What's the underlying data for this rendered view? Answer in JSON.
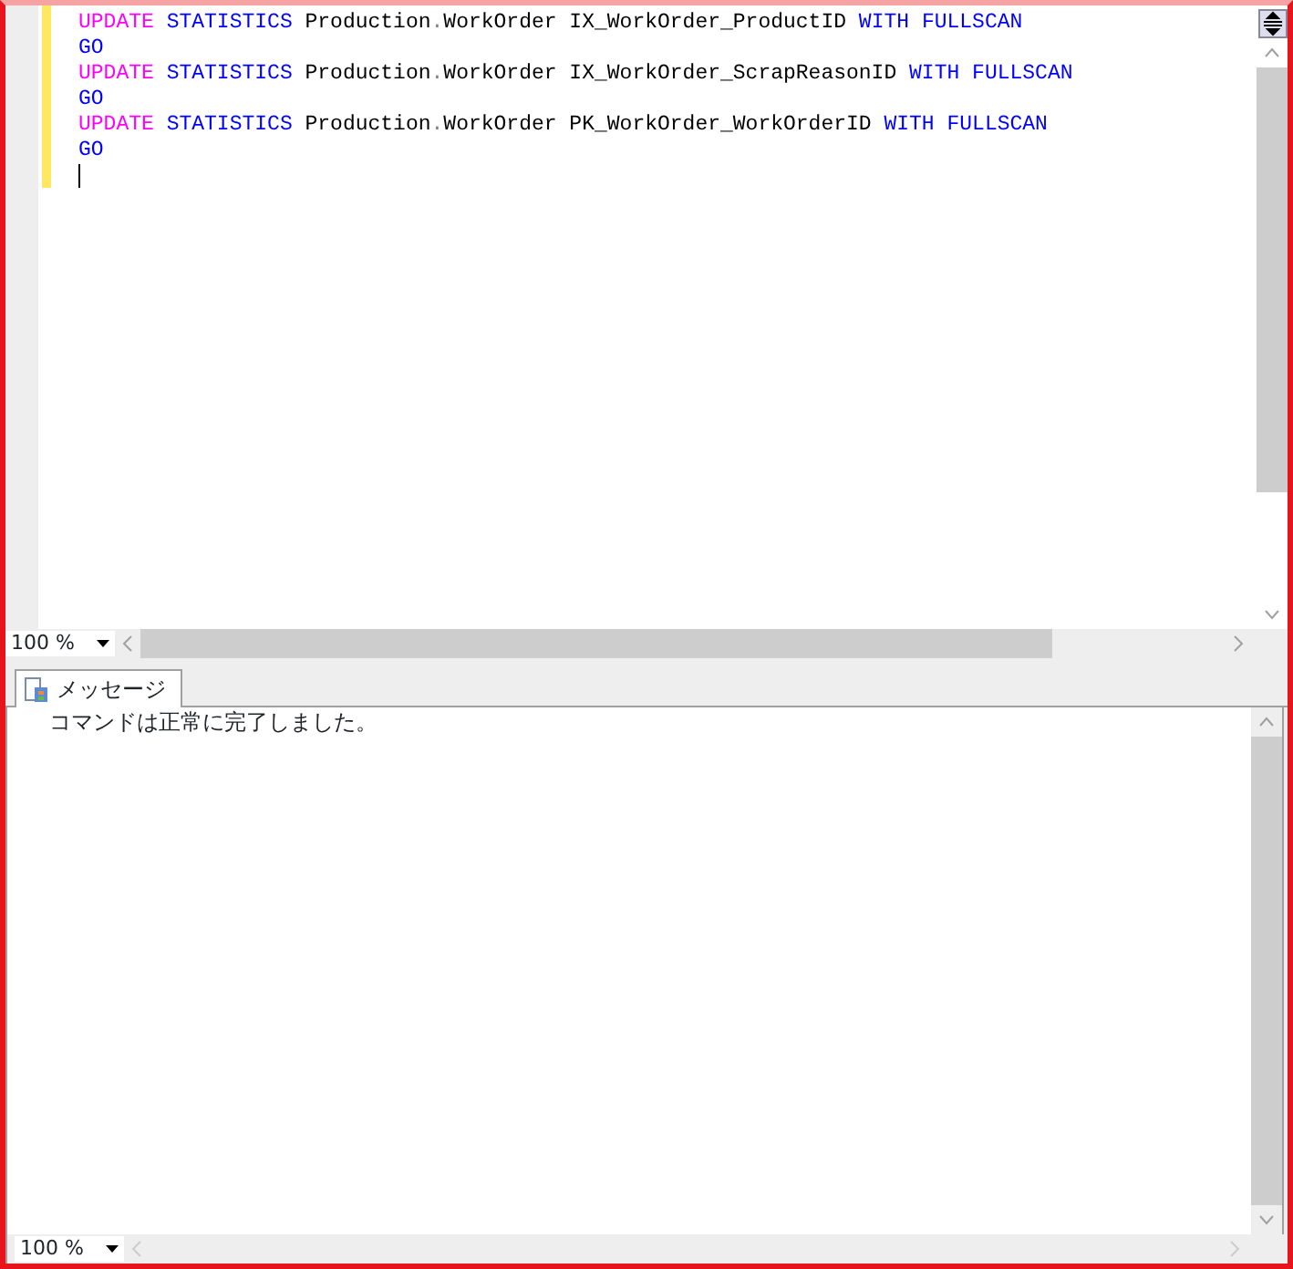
{
  "editor": {
    "lines": [
      {
        "tokens": [
          {
            "kind": "dml",
            "text": "UPDATE"
          },
          {
            "kind": "keyword",
            "text": "STATISTICS"
          },
          {
            "kind": "plain",
            "text": "Production"
          },
          {
            "kind": "operator",
            "text": "."
          },
          {
            "kind": "plain",
            "text": "WorkOrder IX_WorkOrder_ProductID"
          },
          {
            "kind": "keyword",
            "text": "WITH"
          },
          {
            "kind": "keyword",
            "text": "FULLSCAN"
          }
        ]
      },
      {
        "tokens": [
          {
            "kind": "keyword",
            "text": "GO"
          }
        ]
      },
      {
        "tokens": [
          {
            "kind": "dml",
            "text": "UPDATE"
          },
          {
            "kind": "keyword",
            "text": "STATISTICS"
          },
          {
            "kind": "plain",
            "text": "Production"
          },
          {
            "kind": "operator",
            "text": "."
          },
          {
            "kind": "plain",
            "text": "WorkOrder IX_WorkOrder_ScrapReasonID"
          },
          {
            "kind": "keyword",
            "text": "WITH"
          },
          {
            "kind": "keyword",
            "text": "FULLSCAN"
          }
        ]
      },
      {
        "tokens": [
          {
            "kind": "keyword",
            "text": "GO"
          }
        ]
      },
      {
        "tokens": [
          {
            "kind": "dml",
            "text": "UPDATE"
          },
          {
            "kind": "keyword",
            "text": "STATISTICS"
          },
          {
            "kind": "plain",
            "text": "Production"
          },
          {
            "kind": "operator",
            "text": "."
          },
          {
            "kind": "plain",
            "text": "WorkOrder PK_WorkOrder_WorkOrderID"
          },
          {
            "kind": "keyword",
            "text": "WITH"
          },
          {
            "kind": "keyword",
            "text": "FULLSCAN"
          }
        ]
      },
      {
        "tokens": [
          {
            "kind": "keyword",
            "text": "GO"
          }
        ]
      }
    ],
    "zoom": "100 %"
  },
  "results": {
    "tabs": [
      {
        "label": "メッセージ",
        "selected": true
      }
    ],
    "message": "コマンドは正常に完了しました。",
    "zoom": "100 %"
  }
}
